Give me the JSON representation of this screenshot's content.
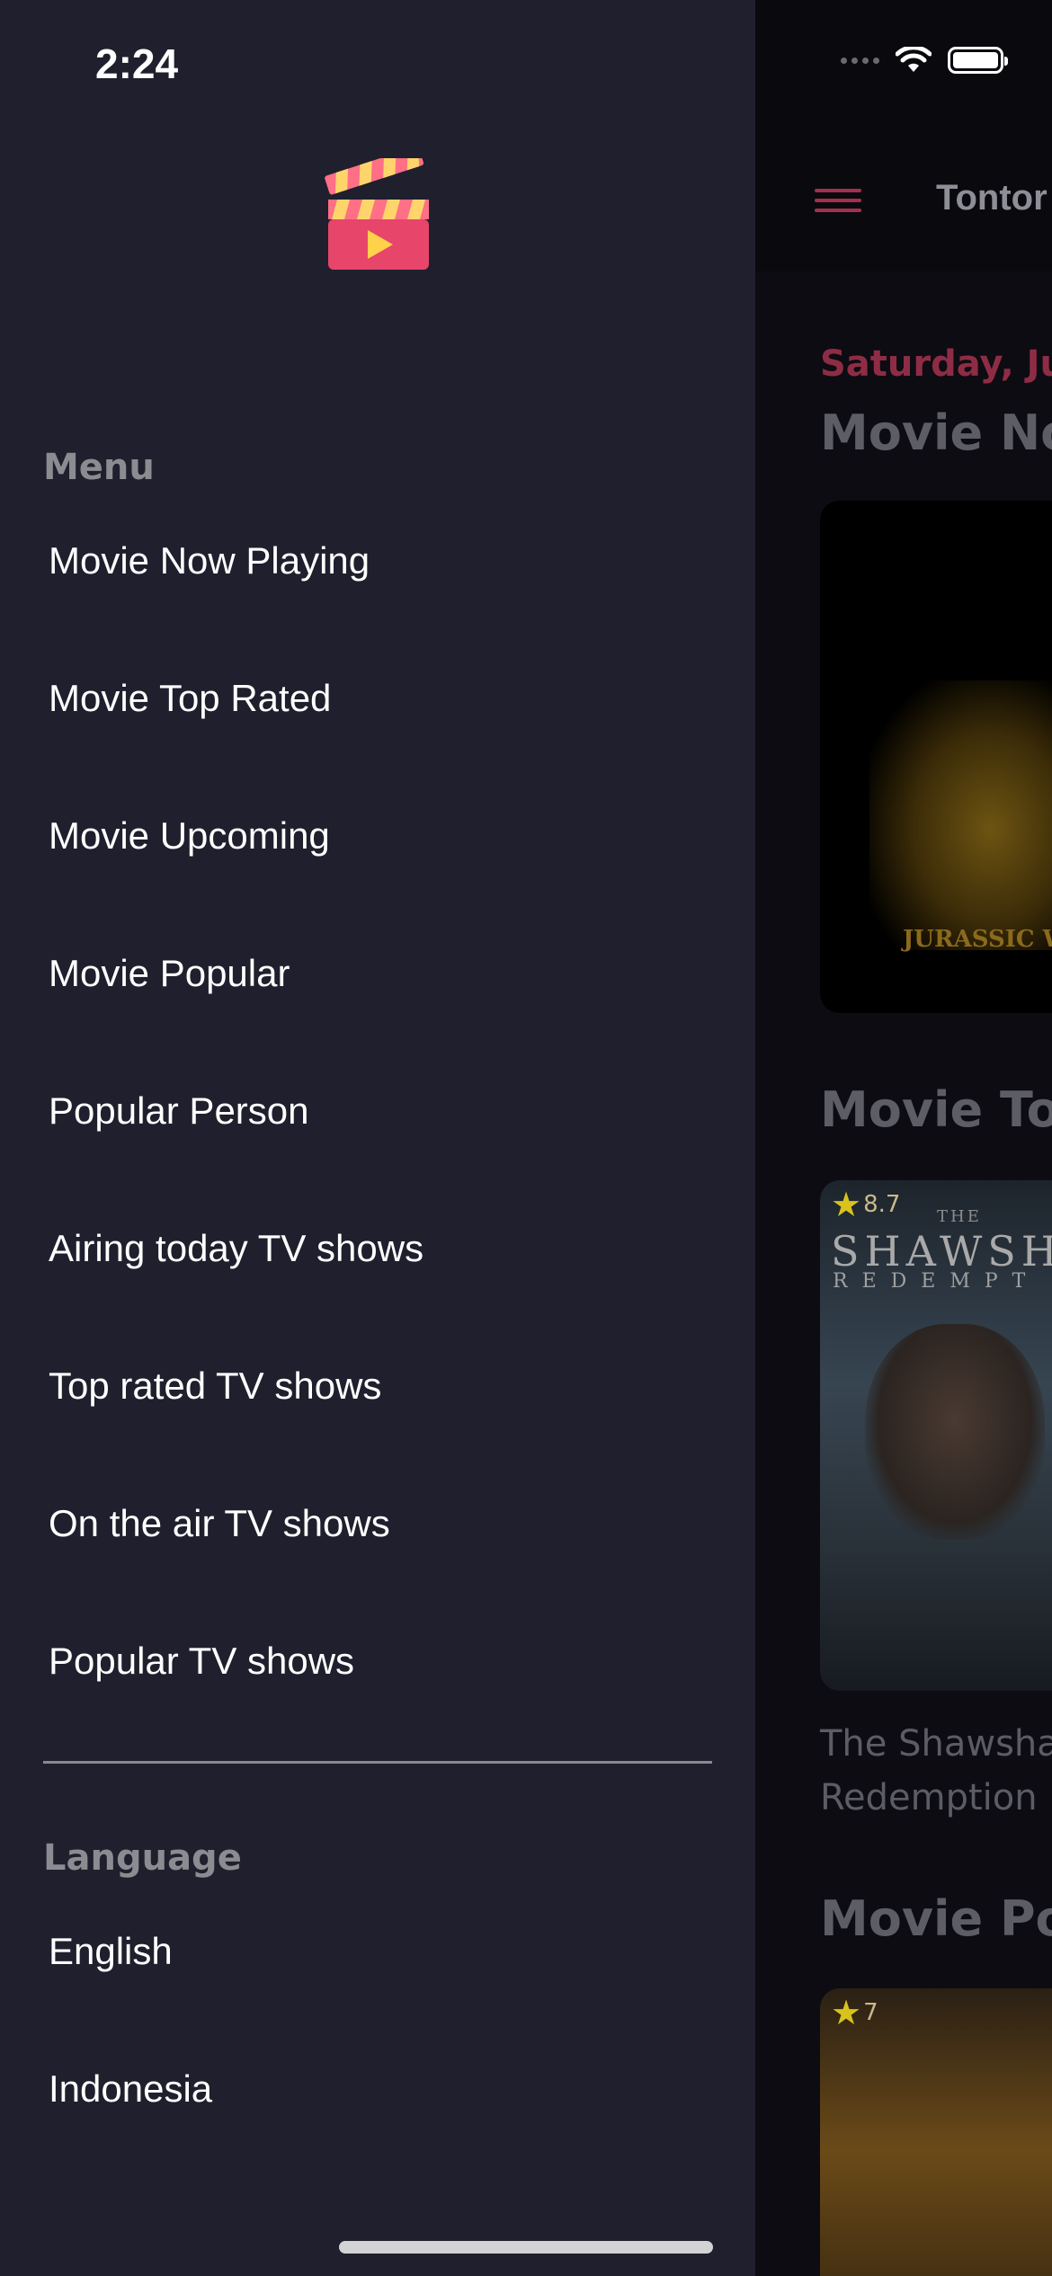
{
  "status_bar": {
    "time": "2:24",
    "icons": [
      "cellular-signal-icon",
      "wifi-icon",
      "battery-icon"
    ],
    "battery_level": 1.0
  },
  "drawer": {
    "logo": "clapperboard-play-logo",
    "menu_section": {
      "label": "Menu",
      "items": [
        {
          "label": "Movie Now Playing"
        },
        {
          "label": "Movie Top Rated"
        },
        {
          "label": "Movie Upcoming"
        },
        {
          "label": "Movie Popular"
        },
        {
          "label": "Popular Person"
        },
        {
          "label": "Airing today TV shows"
        },
        {
          "label": "Top rated TV shows"
        },
        {
          "label": "On the air TV shows"
        },
        {
          "label": "Popular TV shows"
        }
      ]
    },
    "language_section": {
      "label": "Language",
      "items": [
        {
          "label": "English"
        },
        {
          "label": "Indonesia"
        }
      ]
    }
  },
  "background_app": {
    "title": "Tontor",
    "date": "Saturday, Ju",
    "sections": [
      {
        "heading": "Movie Nov",
        "poster_title": "JURASSIC WORLD"
      },
      {
        "heading": "Movie Top",
        "poster_rating": "8.7",
        "poster_title_top": "THE",
        "poster_title": "SHAWSHA",
        "poster_subtitle": "REDEMPT",
        "movie_name_line1": "The Shawsha",
        "movie_name_line2": "Redemption"
      },
      {
        "heading": "Movie Pop",
        "poster_rating": "7"
      }
    ]
  },
  "colors": {
    "drawer_background": "#1f1f2d",
    "accent": "#e8456b",
    "section_label": "#8b8b91",
    "star": "#d8c21c"
  }
}
